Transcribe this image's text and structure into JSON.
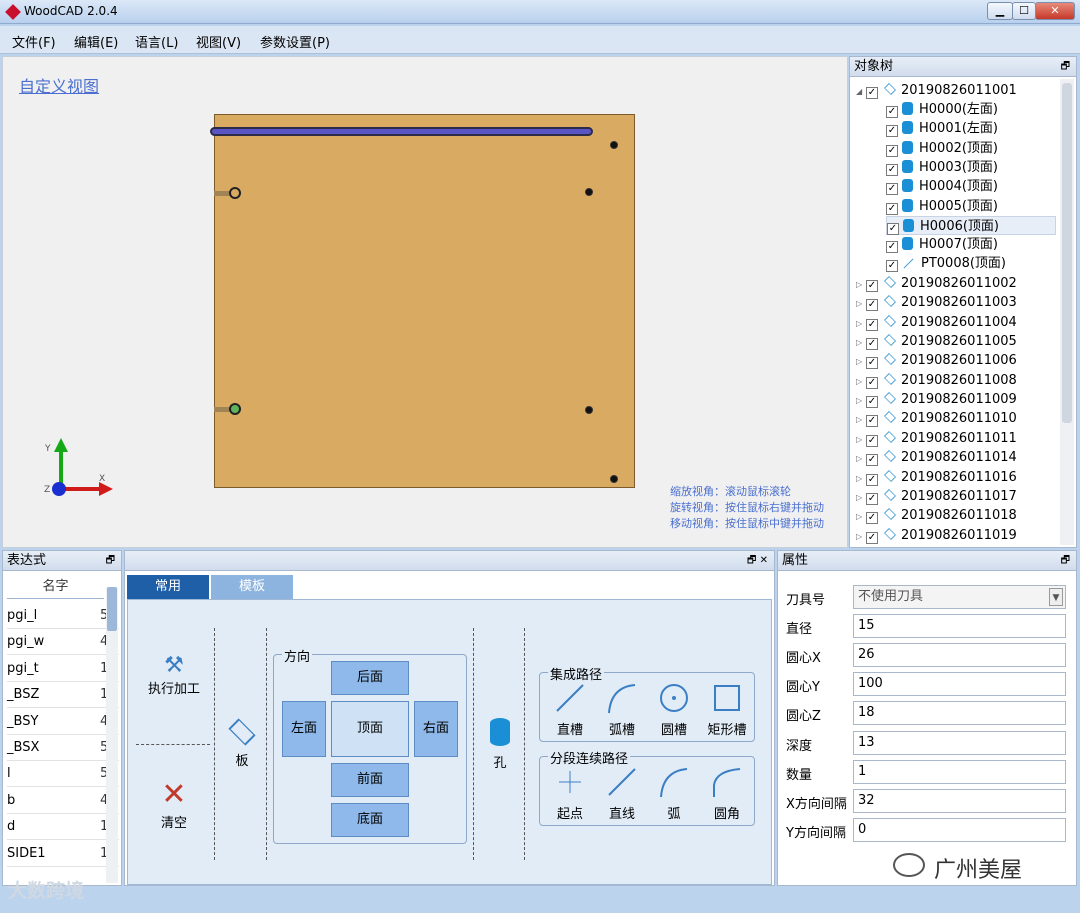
{
  "window": {
    "title": "WoodCAD 2.0.4",
    "min": "▁",
    "max": "☐",
    "close": "✕"
  },
  "menu": [
    "文件(F)",
    "编辑(E)",
    "语言(L)",
    "视图(V)",
    "参数设置(P)"
  ],
  "viewport": {
    "title": "自定义视图",
    "hints": [
      "缩放视角：滚动鼠标滚轮",
      "旋转视角：按住鼠标右键并拖动",
      "移动视角：按住鼠标中键并拖动"
    ],
    "axes": {
      "x": "X",
      "y": "Y",
      "z": "Z"
    },
    "board_color": "#d9aa61",
    "groove_color": "#5a55c4"
  },
  "tree": {
    "title": "对象树",
    "pin": "🗗",
    "root": {
      "label": "20190826011001",
      "expanded": true,
      "checked": true
    },
    "children": [
      {
        "label": "H0000(左面)",
        "icon": "cylinder-icon"
      },
      {
        "label": "H0001(左面)",
        "icon": "cylinder-icon"
      },
      {
        "label": "H0002(顶面)",
        "icon": "cylinder-icon"
      },
      {
        "label": "H0003(顶面)",
        "icon": "cylinder-icon"
      },
      {
        "label": "H0004(顶面)",
        "icon": "cylinder-icon"
      },
      {
        "label": "H0005(顶面)",
        "icon": "cylinder-icon"
      },
      {
        "label": "H0006(顶面)",
        "icon": "cylinder-icon",
        "selected": true
      },
      {
        "label": "H0007(顶面)",
        "icon": "cylinder-icon"
      },
      {
        "label": "PT0008(顶面)",
        "icon": "line-icon"
      }
    ],
    "siblings": [
      "20190826011002",
      "20190826011003",
      "20190826011004",
      "20190826011005",
      "20190826011006",
      "20190826011008",
      "20190826011009",
      "20190826011010",
      "20190826011011",
      "20190826011014",
      "20190826011016",
      "20190826011017",
      "20190826011018",
      "20190826011019"
    ]
  },
  "expr": {
    "title": "表达式",
    "pin": "🗗",
    "col_name": "名字",
    "rows": [
      {
        "name": "pgi_l",
        "value": "5"
      },
      {
        "name": "pgi_w",
        "value": "4"
      },
      {
        "name": "pgi_t",
        "value": "1"
      },
      {
        "name": "_BSZ",
        "value": "1"
      },
      {
        "name": "_BSY",
        "value": "4"
      },
      {
        "name": "_BSX",
        "value": "5"
      },
      {
        "name": "l",
        "value": "5"
      },
      {
        "name": "b",
        "value": "4"
      },
      {
        "name": "d",
        "value": "1"
      },
      {
        "name": "SIDE1",
        "value": "1"
      }
    ]
  },
  "ops": {
    "pin": "🗗 ✕",
    "tabs": [
      "常用",
      "模板"
    ],
    "execute": "执行加工",
    "clear": "清空",
    "board": "板",
    "direction_title": "方向",
    "faces": {
      "back": "后面",
      "left": "左面",
      "top": "顶面",
      "right": "右面",
      "front": "前面",
      "bottom": "底面"
    },
    "hole": "孔",
    "integrated_title": "集成路径",
    "integrated": [
      "直槽",
      "弧槽",
      "圆槽",
      "矩形槽"
    ],
    "segment_title": "分段连续路径",
    "segment": [
      "起点",
      "直线",
      "弧",
      "圆角"
    ]
  },
  "props": {
    "title": "属性",
    "pin": "🗗",
    "fields": [
      {
        "label": "刀具号",
        "value": "不使用刀具",
        "type": "select"
      },
      {
        "label": "直径",
        "value": "15"
      },
      {
        "label": "圆心X",
        "value": "26"
      },
      {
        "label": "圆心Y",
        "value": "100"
      },
      {
        "label": "圆心Z",
        "value": "18"
      },
      {
        "label": "深度",
        "value": "13"
      },
      {
        "label": "数量",
        "value": "1"
      },
      {
        "label": "X方向间隔",
        "value": "32"
      },
      {
        "label": "Y方向间隔",
        "value": "0"
      }
    ]
  },
  "watermark": "广州美屋",
  "brand": "大数跨境"
}
